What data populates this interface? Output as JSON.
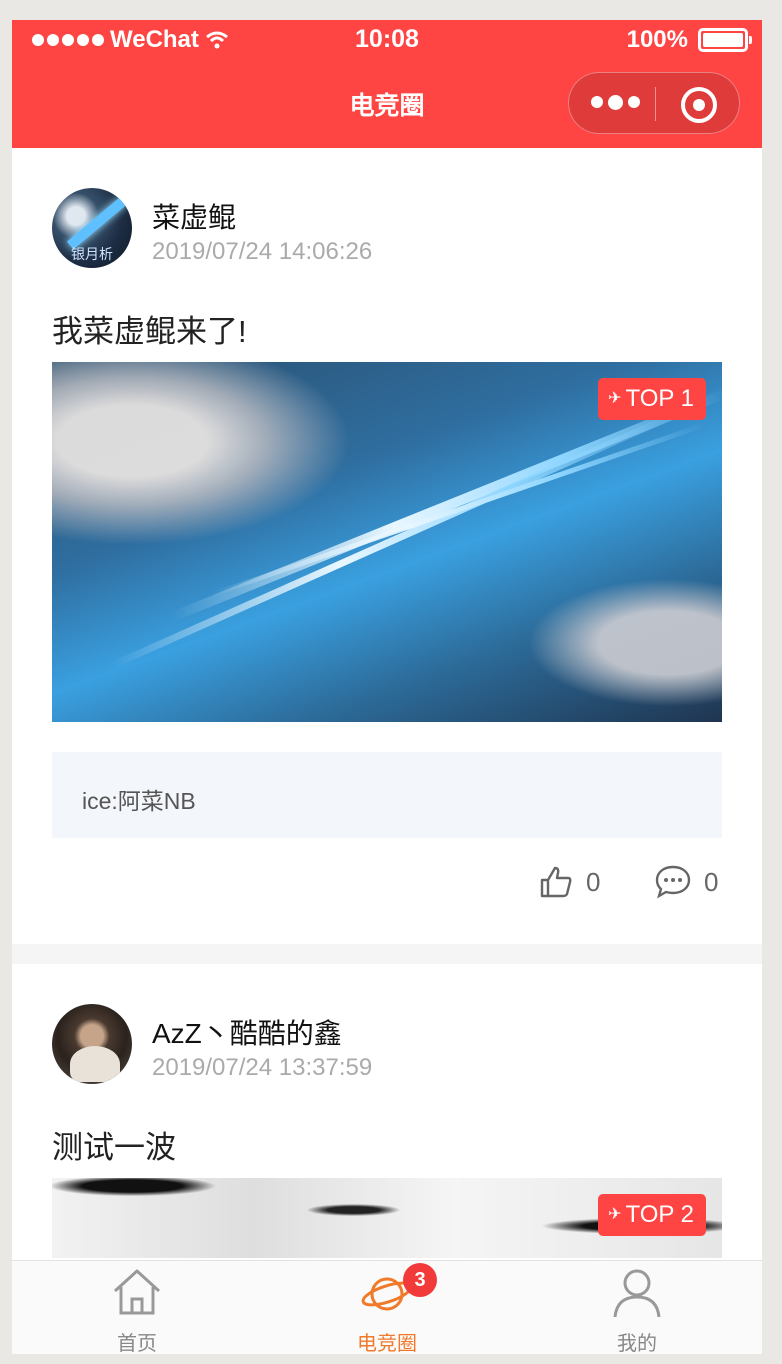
{
  "status_bar": {
    "carrier": "WeChat",
    "time": "10:08",
    "battery": "100%"
  },
  "nav": {
    "title": "电竞圈"
  },
  "posts": [
    {
      "username": "菜虚鲲",
      "avatar_text": "银月析",
      "timestamp": "2019/07/24 14:06:26",
      "content": "我菜虚鲲来了!",
      "badge": "TOP 1",
      "comment": "ice:阿菜NB",
      "likes": "0",
      "comments": "0"
    },
    {
      "username": "AzZ丶酷酷的鑫",
      "timestamp": "2019/07/24 13:37:59",
      "content": "测试一波",
      "badge": "TOP 2"
    }
  ],
  "tabbar": {
    "tabs": [
      {
        "label": "首页",
        "icon": "home-icon"
      },
      {
        "label": "电竞圈",
        "icon": "planet-icon",
        "badge": "3"
      },
      {
        "label": "我的",
        "icon": "person-icon"
      }
    ],
    "active_color": "#f07a2a"
  },
  "colors": {
    "primary": "#ff4444",
    "badge": "#ff4444"
  }
}
